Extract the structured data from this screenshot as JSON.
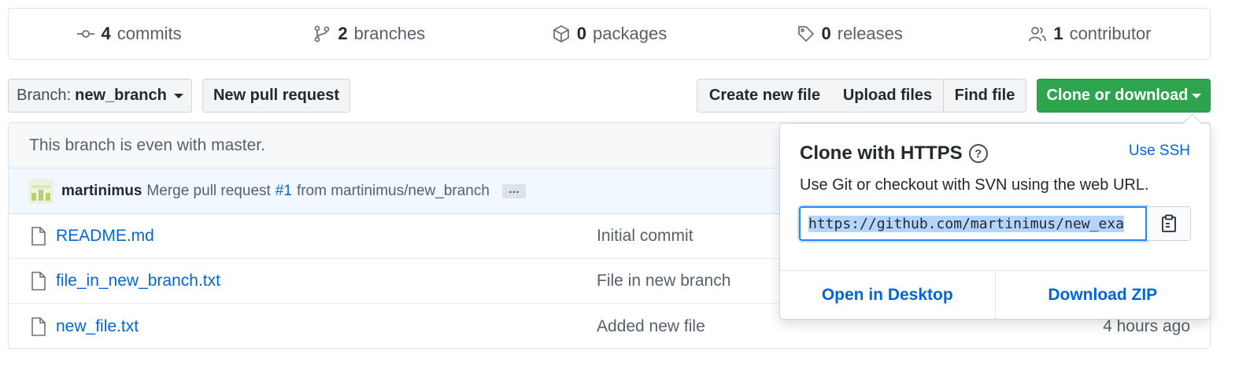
{
  "summary": {
    "commits": {
      "count": "4",
      "label": "commits"
    },
    "branches": {
      "count": "2",
      "label": "branches"
    },
    "packages": {
      "count": "0",
      "label": "packages"
    },
    "releases": {
      "count": "0",
      "label": "releases"
    },
    "contributors": {
      "count": "1",
      "label": "contributor"
    }
  },
  "toolbar": {
    "branch_prefix": "Branch:",
    "branch_name": "new_branch",
    "new_pull_request": "New pull request",
    "create_new_file": "Create new file",
    "upload_files": "Upload files",
    "find_file": "Find file",
    "clone_or_download": "Clone or download"
  },
  "branch_status": "This branch is even with master.",
  "latest_commit": {
    "author": "martinimus",
    "message_prefix": "Merge pull request",
    "pr_link": "#1",
    "message_suffix": "from martinimus/new_branch",
    "ellipsis": "…"
  },
  "files": [
    {
      "name": "README.md",
      "message": "Initial commit",
      "age": ""
    },
    {
      "name": "file_in_new_branch.txt",
      "message": "File in new branch",
      "age": ""
    },
    {
      "name": "new_file.txt",
      "message": "Added new file",
      "age": "4 hours ago"
    }
  ],
  "clone_popover": {
    "title": "Clone with HTTPS",
    "help_glyph": "?",
    "use_ssh": "Use SSH",
    "description": "Use Git or checkout with SVN using the web URL.",
    "url": "https://github.com/martinimus/new_exa",
    "open_in_desktop": "Open in Desktop",
    "download_zip": "Download ZIP"
  },
  "colors": {
    "accent_green": "#2ea44f",
    "link_blue": "#0366d6",
    "commit_bg": "#f1f8ff"
  },
  "icons": [
    "commit-icon",
    "branch-icon",
    "package-icon",
    "tag-icon",
    "people-icon",
    "file-icon",
    "help-icon",
    "clipboard-icon"
  ]
}
